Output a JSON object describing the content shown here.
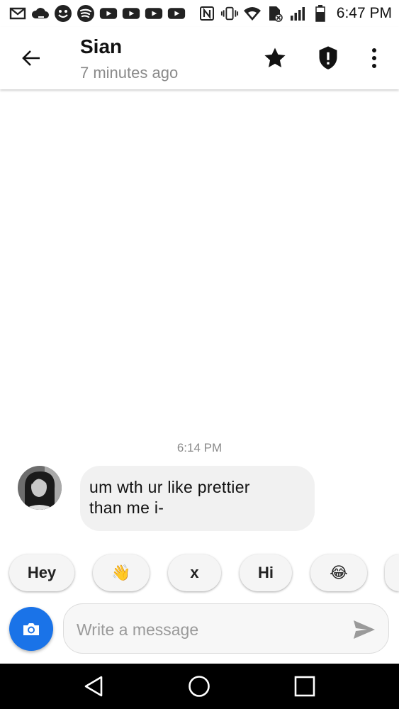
{
  "status_bar": {
    "time": "6:47 PM",
    "left_icons": [
      "gmail-icon",
      "cloud-icon",
      "smiley-icon",
      "spotify-icon",
      "youtube-icon",
      "youtube-icon",
      "youtube-icon",
      "youtube-icon"
    ],
    "right_icons": [
      "nfc-icon",
      "vibrate-icon",
      "wifi-icon",
      "no-sim-icon",
      "signal-icon",
      "battery-icon"
    ]
  },
  "header": {
    "title": "Sian",
    "subtitle": "7 minutes ago",
    "icons": [
      "back-arrow-icon",
      "star-icon",
      "shield-alert-icon",
      "more-vert-icon"
    ]
  },
  "conversation": {
    "timestamp": "6:14 PM",
    "messages": [
      {
        "line1": "um wth ur like prettier",
        "line2": "than me i-"
      }
    ]
  },
  "quick_replies": [
    "Hey",
    "👋",
    "x",
    "Hi",
    "😂"
  ],
  "composer": {
    "placeholder": "Write a message",
    "accent": "#1a73e8"
  },
  "nav": {
    "icons": [
      "back-triangle-icon",
      "home-circle-icon",
      "recents-square-icon"
    ]
  }
}
